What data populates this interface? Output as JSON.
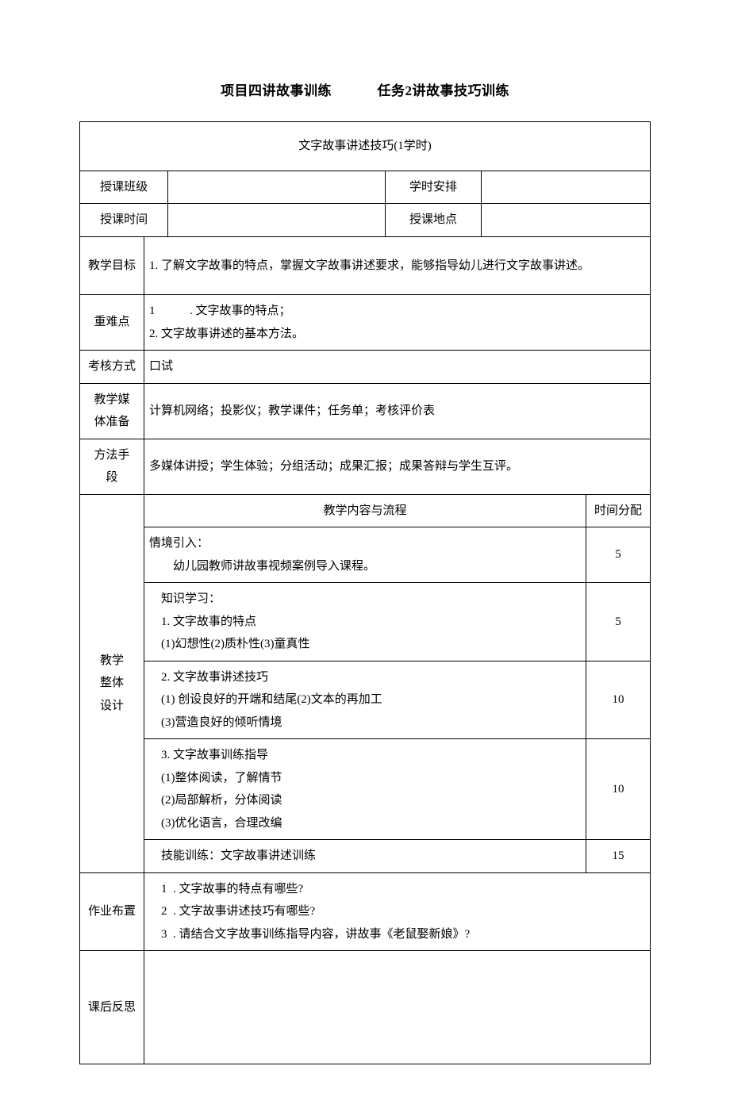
{
  "title": {
    "left": "项目四讲故事训练",
    "right": "任务2讲故事技巧训练"
  },
  "header": {
    "lesson_title": "文字故事讲述技巧(1学时)",
    "row1": {
      "label_class": "授课班级",
      "label_hours": "学时安排"
    },
    "row2": {
      "label_time": "授课时间",
      "label_place": "授课地点"
    }
  },
  "objective": {
    "label": "教学目标",
    "text": "1. 了解文字故事的特点，掌握文字故事讲述要求，能够指导幼儿进行文字故事讲述。"
  },
  "keypoints": {
    "label": "重难点",
    "line_num": "1",
    "line1": ". 文字故事的特点；",
    "line2": "2. 文字故事讲述的基本方法。"
  },
  "exam": {
    "label": "考核方式",
    "text": "口试"
  },
  "media": {
    "label1": "教学媒",
    "label2": "体准备",
    "text": "计算机网络；投影仪；教学课件；任务单；考核评价表"
  },
  "method": {
    "label1": "方法手",
    "label2": "段",
    "text": "多媒体讲授；学生体验；分组活动；成果汇报；成果答辩与学生互评。"
  },
  "design": {
    "label1": "教学",
    "label2": "整体",
    "label3": "设计",
    "header_content": "教学内容与流程",
    "header_time": "时间分配",
    "rows": [
      {
        "lines": [
          {
            "cls": "",
            "text": "情境引入："
          },
          {
            "cls": "indent2",
            "text": "幼儿园教师讲故事视频案例导入课程。"
          }
        ],
        "time": "5"
      },
      {
        "lines": [
          {
            "cls": "indent1",
            "text": "知识学习："
          },
          {
            "cls": "indent1",
            "text": "1. 文字故事的特点"
          },
          {
            "cls": "indent1",
            "text": "(1)幻想性(2)质朴性(3)童真性"
          }
        ],
        "time": "5"
      },
      {
        "lines": [
          {
            "cls": "indent1",
            "text": "2. 文字故事讲述技巧"
          },
          {
            "cls": "indent1",
            "text": "(1) 创设良好的开端和结尾(2)文本的再加工"
          },
          {
            "cls": "indent1",
            "text": "(3)营造良好的倾听情境"
          }
        ],
        "time": "10"
      },
      {
        "lines": [
          {
            "cls": "indent1",
            "text": "3. 文字故事训练指导"
          },
          {
            "cls": "indent1",
            "text": "(1)整体阅读，了解情节"
          },
          {
            "cls": "indent1",
            "text": "(2)局部解析，分体阅读"
          },
          {
            "cls": "indent1",
            "text": "(3)优化语言，合理改编"
          }
        ],
        "time": "10"
      },
      {
        "lines": [
          {
            "cls": "indent1",
            "text": "技能训练：文字故事讲述训练"
          }
        ],
        "time": "15"
      }
    ]
  },
  "homework": {
    "label": "作业布置",
    "nums": {
      "n1": "1",
      "n2": "2",
      "n3": "3"
    },
    "line1": ". 文字故事的特点有哪些?",
    "line2": ". 文字故事讲述技巧有哪些?",
    "line3": ". 请结合文字故事训练指导内容，讲故事《老鼠娶新娘》?"
  },
  "reflect": {
    "label": "课后反思"
  }
}
